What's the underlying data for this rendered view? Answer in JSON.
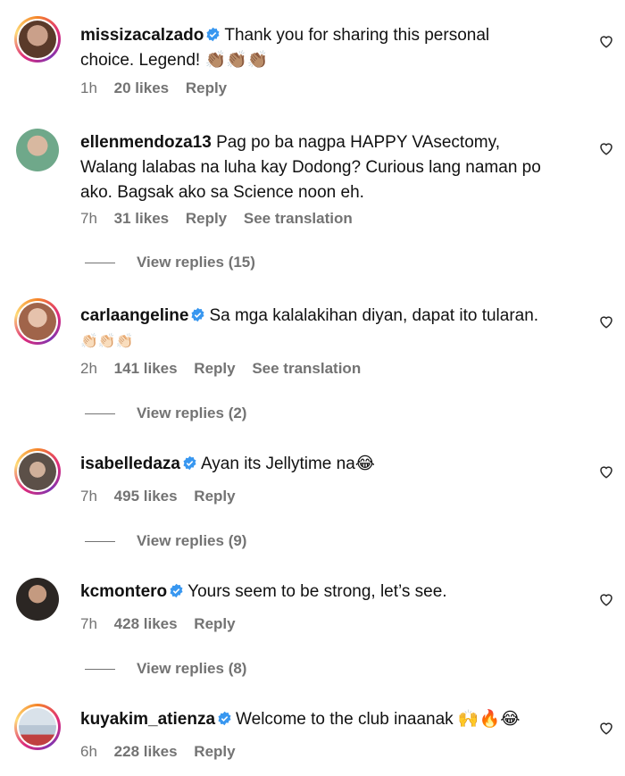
{
  "comments": [
    {
      "username": "missizacalzado",
      "verified": true,
      "text_line1": "Thank you for sharing this personal",
      "text_line2": "choice. Legend! 👏🏽👏🏽👏🏽",
      "time": "1h",
      "likes": "20 likes",
      "reply": "Reply",
      "avatar_color": "#8a6a55"
    },
    {
      "username": "ellenmendoza13",
      "verified": false,
      "text_line1": "Pag po ba nagpa HAPPY VAsectomy,",
      "text_line2": "Walang lalabas na luha kay Dodong? Curious lang naman po",
      "text_line3": "ako. Bagsak ako sa Science noon eh.",
      "time": "7h",
      "likes": "31 likes",
      "reply": "Reply",
      "translation": "See translation",
      "view_replies": "View replies (15)",
      "avatar_color": "#6fa88a"
    },
    {
      "username": "carlaangeline",
      "verified": true,
      "text_line1": "Sa mga kalalakihan diyan, dapat ito tularan.",
      "text_line2": "👏🏻👏🏻👏🏻",
      "time": "2h",
      "likes": "141 likes",
      "reply": "Reply",
      "translation": "See translation",
      "view_replies": "View replies (2)",
      "avatar_color": "#c9a48c"
    },
    {
      "username": "isabelledaza",
      "verified": true,
      "text_line1": "Ayan its Jellytime na😂",
      "time": "7h",
      "likes": "495 likes",
      "reply": "Reply",
      "view_replies": "View replies (9)",
      "avatar_color": "#7c6c60"
    },
    {
      "username": "kcmontero",
      "verified": true,
      "text_line1": "Yours seem to be strong, let’s see.",
      "time": "7h",
      "likes": "428 likes",
      "reply": "Reply",
      "view_replies": "View replies (8)",
      "avatar_color": "#5a4a42"
    },
    {
      "username": "kuyakim_atienza",
      "verified": true,
      "text_line1": "Welcome to the club inaanak 🙌🔥😂",
      "time": "6h",
      "likes": "228 likes",
      "reply": "Reply",
      "avatar_color": "#b8c6d4"
    }
  ],
  "colors": {
    "verified": "#3897f0",
    "muted": "#737373"
  }
}
